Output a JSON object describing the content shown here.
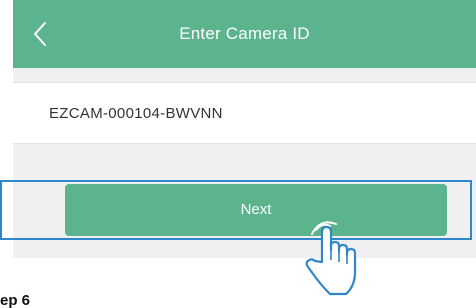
{
  "header": {
    "title": "Enter Camera ID",
    "back_icon": "chevron-left-icon"
  },
  "camera_id": {
    "value": "EZCAM-000104-BWVNN"
  },
  "next_button": {
    "label": "Next"
  },
  "overlay": {
    "hand_icon": "pointing-hand-icon",
    "highlight_color": "#2f86c8"
  },
  "caption": {
    "step": "ep 6"
  },
  "colors": {
    "accent": "#5cb48e",
    "background": "#f0f0f2"
  }
}
